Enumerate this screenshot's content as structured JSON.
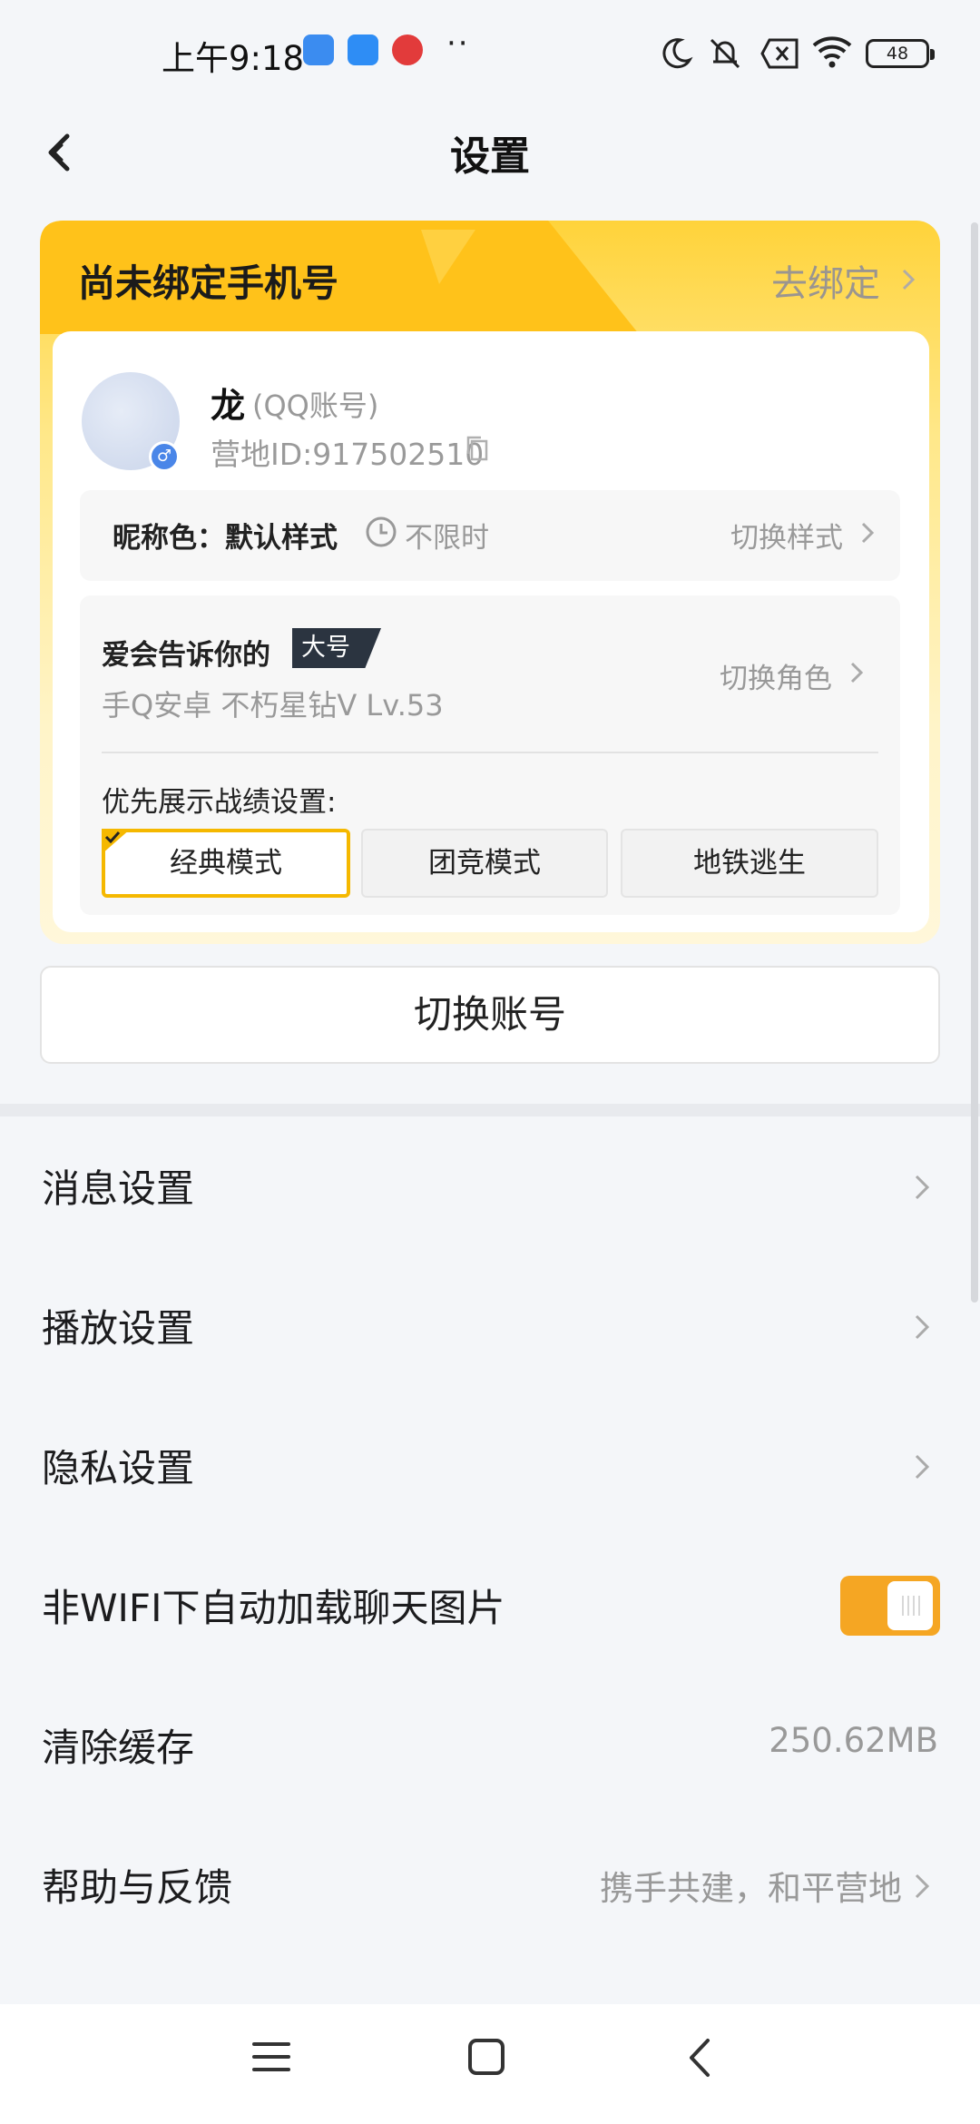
{
  "status_bar": {
    "time": "上午9:18",
    "dots": "··",
    "battery": "48"
  },
  "header": {
    "title": "设置"
  },
  "bind_phone": {
    "title": "尚未绑定手机号",
    "action": "去绑定"
  },
  "profile": {
    "name": "龙",
    "account_type": "(QQ账号)",
    "id_text": "营地ID:917502510",
    "gender_symbol": "♂"
  },
  "nickname_color": {
    "label": "昵称色：默认样式",
    "limit": "不限时",
    "switch_label": "切换样式"
  },
  "role": {
    "name": "爱会告诉你的",
    "badge": "大号",
    "sub": "手Q安卓  不朽星钻V  Lv.53",
    "switch_label": "切换角色",
    "pref_label": "优先展示战绩设置:",
    "modes": [
      "经典模式",
      "团竞模式",
      "地铁逃生"
    ],
    "selected_mode": "经典模式"
  },
  "switch_account": "切换账号",
  "menu": {
    "items": [
      {
        "label": "消息设置"
      },
      {
        "label": "播放设置"
      },
      {
        "label": "隐私设置"
      },
      {
        "label": "非WIFI下自动加载聊天图片",
        "toggle": true
      },
      {
        "label": "清除缓存",
        "value": "250.62MB"
      },
      {
        "label": "帮助与反馈",
        "value": "携手共建，和平营地"
      }
    ]
  },
  "colors": {
    "accent": "#f5b800",
    "toggle_on": "#f5a623",
    "card_top": "#ffd33a"
  }
}
